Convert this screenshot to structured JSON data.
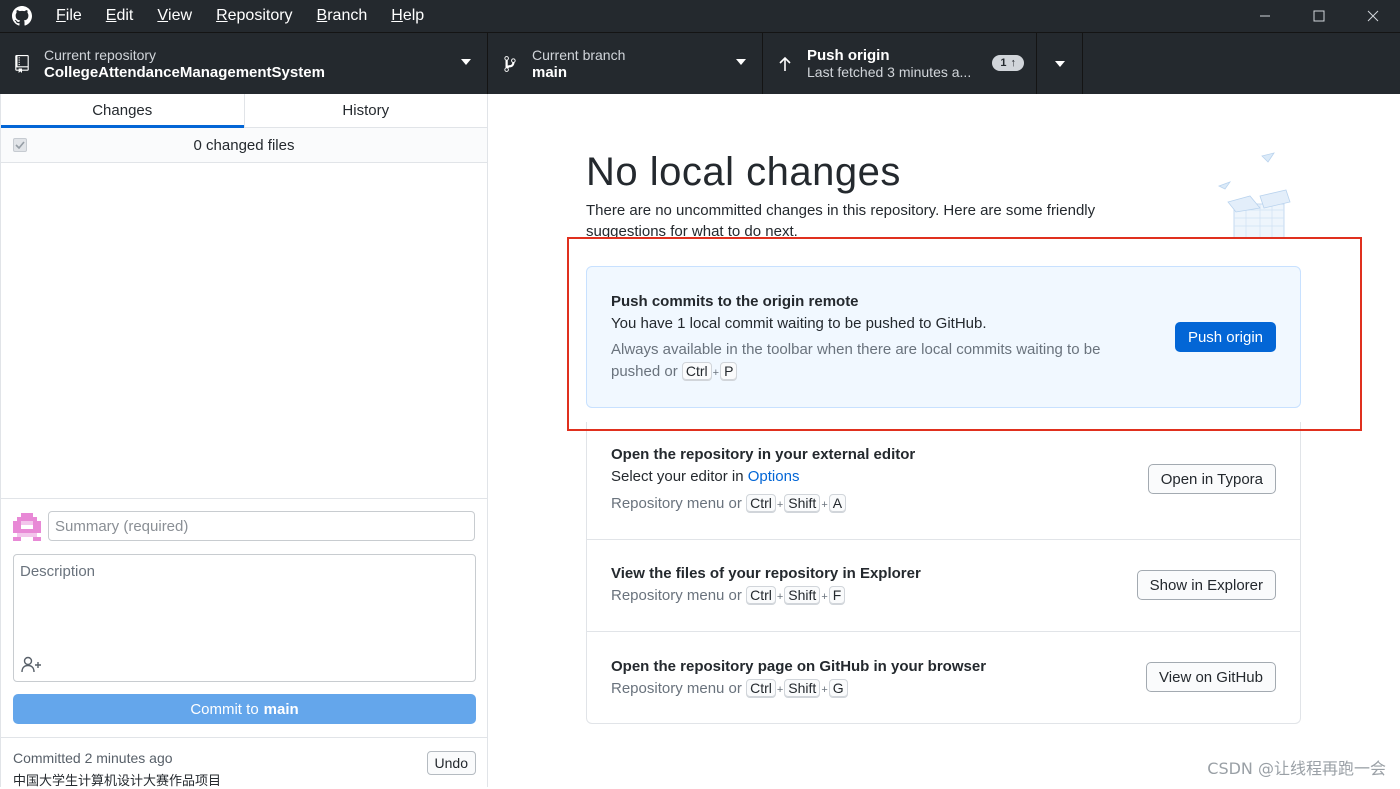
{
  "menu": {
    "items": [
      {
        "key": "F",
        "rest": "ile"
      },
      {
        "key": "E",
        "rest": "dit"
      },
      {
        "key": "V",
        "rest": "iew"
      },
      {
        "key": "R",
        "rest": "epository"
      },
      {
        "key": "B",
        "rest": "ranch"
      },
      {
        "key": "H",
        "rest": "elp"
      }
    ]
  },
  "window": {
    "minimize": "—",
    "maximize": "☐",
    "close": "✕"
  },
  "toolbar": {
    "repo_label": "Current repository",
    "repo_value": "CollegeAttendanceManagementSystem",
    "branch_label": "Current branch",
    "branch_value": "main",
    "push_label": "Push origin",
    "push_value": "Last fetched 3 minutes a...",
    "ahead_count": "1",
    "ahead_arrow": "↑"
  },
  "sidebar": {
    "tabs": [
      "Changes",
      "History"
    ],
    "active_tab": 0,
    "files_count": "0 changed files",
    "summary_placeholder": "Summary (required)",
    "description_placeholder": "Description",
    "commit_prefix": "Commit to",
    "commit_branch": "main",
    "last_commit_time": "Committed 2 minutes ago",
    "last_commit_message": "中国大学生计算机设计大赛作品项目",
    "undo_label": "Undo"
  },
  "main": {
    "title": "No local changes",
    "subtitle": "There are no uncommitted changes in this repository. Here are some friendly suggestions for what to do next.",
    "push_card": {
      "title": "Push commits to the origin remote",
      "desc": "You have 1 local commit waiting to be pushed to GitHub.",
      "hint": "Always available in the toolbar when there are local commits waiting to be pushed or",
      "keys": [
        "Ctrl",
        "P"
      ],
      "button": "Push origin"
    },
    "editor_card": {
      "title": "Open the repository in your external editor",
      "desc_prefix": "Select your editor in",
      "desc_link": "Options",
      "hint": "Repository menu or",
      "keys": [
        "Ctrl",
        "Shift",
        "A"
      ],
      "button": "Open in Typora"
    },
    "explorer_card": {
      "title": "View the files of your repository in Explorer",
      "hint": "Repository menu or",
      "keys": [
        "Ctrl",
        "Shift",
        "F"
      ],
      "button": "Show in Explorer"
    },
    "github_card": {
      "title": "Open the repository page on GitHub in your browser",
      "hint": "Repository menu or",
      "keys": [
        "Ctrl",
        "Shift",
        "G"
      ],
      "button": "View on GitHub"
    }
  },
  "watermark": "CSDN @让线程再跑一会",
  "colors": {
    "accent": "#0366d6",
    "toolbar_bg": "#24292e",
    "highlight": "#e0301e",
    "push_card_bg": "#f1f8ff"
  },
  "icons": [
    "github-logo-icon",
    "repo-icon",
    "branch-icon",
    "arrow-up-icon",
    "chevron-down-icon",
    "checkmark-icon",
    "avatar-icon",
    "add-coauthor-icon"
  ]
}
